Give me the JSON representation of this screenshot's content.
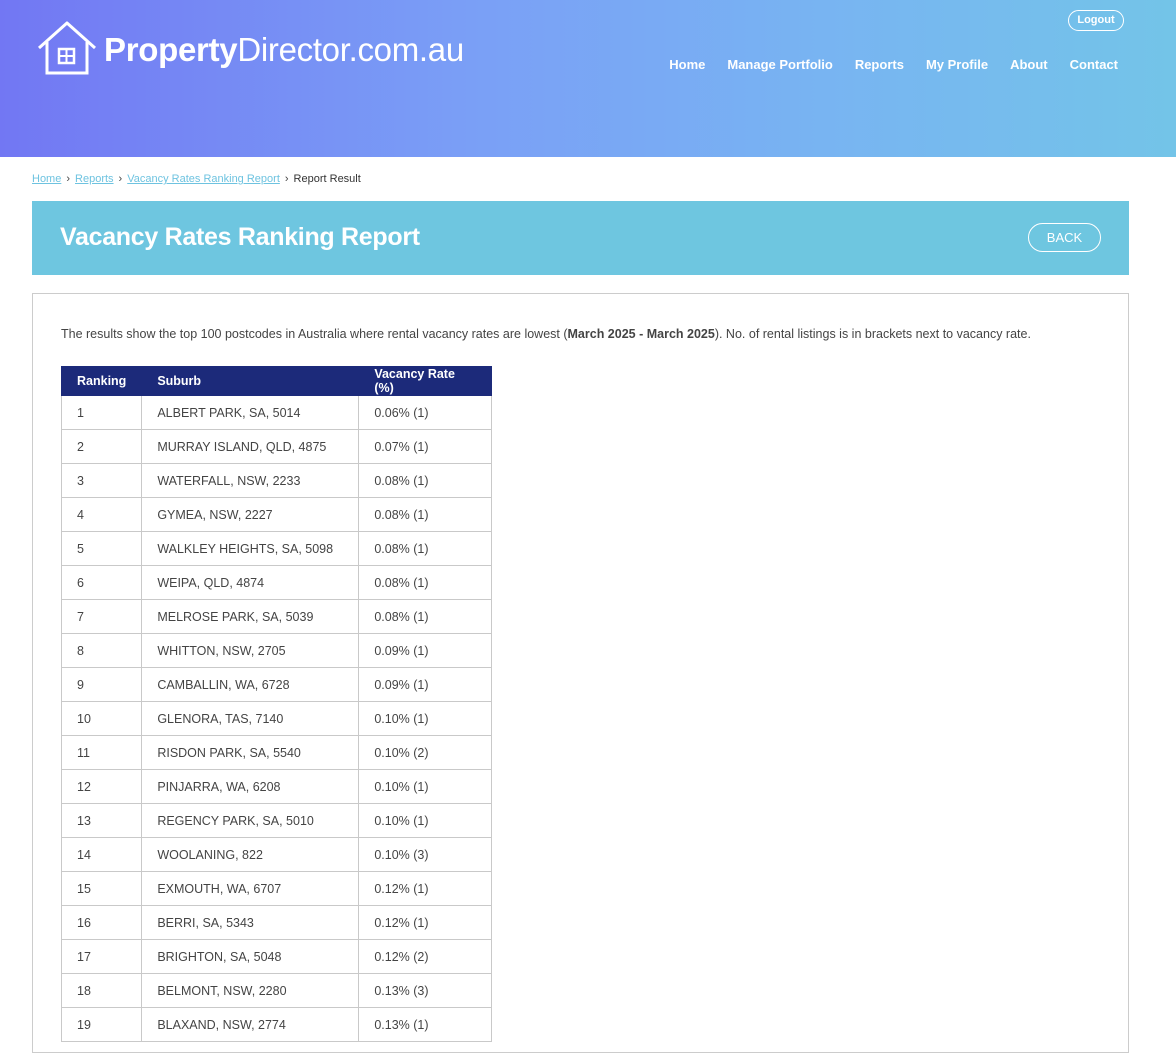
{
  "brand": {
    "name_bold": "Property",
    "name_rest": "Director.com.au"
  },
  "header": {
    "logout_label": "Logout",
    "nav": [
      "Home",
      "Manage Portfolio",
      "Reports",
      "My Profile",
      "About",
      "Contact"
    ]
  },
  "breadcrumb": {
    "items": [
      "Home",
      "Reports",
      "Vacancy Rates Ranking Report"
    ],
    "current": "Report Result"
  },
  "page": {
    "title": "Vacancy Rates Ranking Report",
    "back_label": "BACK",
    "description_before": "The results show the top 100 postcodes in Australia where rental vacancy rates are lowest (",
    "description_bold": "March 2025 - March 2025",
    "description_after": "). No. of rental listings is in brackets next to vacancy rate."
  },
  "table": {
    "headers": [
      "Ranking",
      "Suburb",
      "Vacancy Rate (%)"
    ],
    "rows": [
      [
        "1",
        "ALBERT PARK, SA, 5014",
        "0.06% (1)"
      ],
      [
        "2",
        "MURRAY ISLAND, QLD, 4875",
        "0.07% (1)"
      ],
      [
        "3",
        "WATERFALL, NSW, 2233",
        "0.08% (1)"
      ],
      [
        "4",
        "GYMEA, NSW, 2227",
        "0.08% (1)"
      ],
      [
        "5",
        "WALKLEY HEIGHTS, SA, 5098",
        "0.08% (1)"
      ],
      [
        "6",
        "WEIPA, QLD, 4874",
        "0.08% (1)"
      ],
      [
        "7",
        "MELROSE PARK, SA, 5039",
        "0.08% (1)"
      ],
      [
        "8",
        "WHITTON, NSW, 2705",
        "0.09% (1)"
      ],
      [
        "9",
        "CAMBALLIN, WA, 6728",
        "0.09% (1)"
      ],
      [
        "10",
        "GLENORA, TAS, 7140",
        "0.10% (1)"
      ],
      [
        "11",
        "RISDON PARK, SA, 5540",
        "0.10% (2)"
      ],
      [
        "12",
        "PINJARRA, WA, 6208",
        "0.10% (1)"
      ],
      [
        "13",
        "REGENCY PARK, SA, 5010",
        "0.10% (1)"
      ],
      [
        "14",
        "WOOLANING, 822",
        "0.10% (3)"
      ],
      [
        "15",
        "EXMOUTH, WA, 6707",
        "0.12% (1)"
      ],
      [
        "16",
        "BERRI, SA, 5343",
        "0.12% (1)"
      ],
      [
        "17",
        "BRIGHTON, SA, 5048",
        "0.12% (2)"
      ],
      [
        "18",
        "BELMONT, NSW, 2280",
        "0.13% (3)"
      ],
      [
        "19",
        "BLAXAND, NSW, 2774",
        "0.13% (1)"
      ]
    ]
  }
}
